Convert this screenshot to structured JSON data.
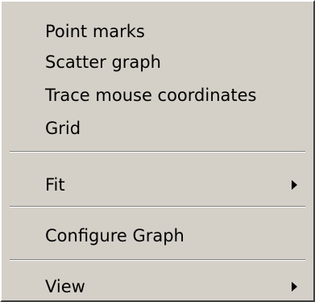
{
  "menu": {
    "items": [
      {
        "label": "Point marks"
      },
      {
        "label": "Scatter graph"
      },
      {
        "label": "Trace mouse coordinates"
      },
      {
        "label": "Grid"
      },
      {
        "label": "Fit",
        "submenu": true
      },
      {
        "label": "Configure Graph"
      },
      {
        "label": "View",
        "submenu": true
      }
    ]
  }
}
